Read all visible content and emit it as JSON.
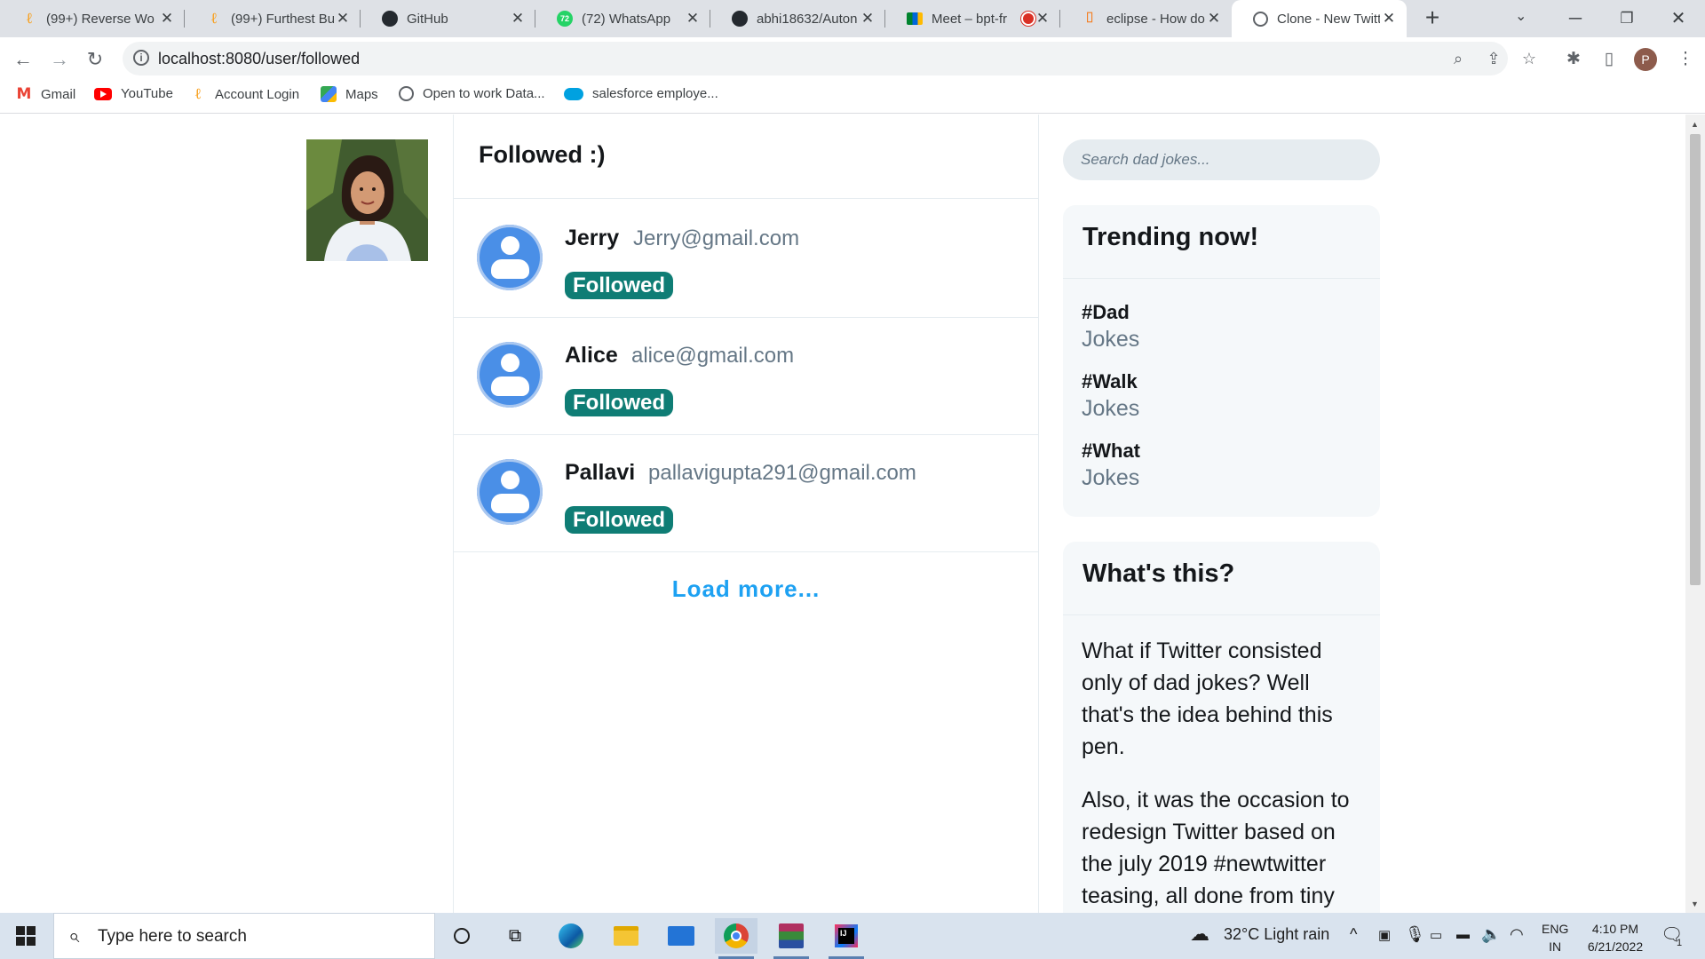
{
  "browser": {
    "tabs": [
      {
        "title": "(99+) Reverse Wo",
        "favicon": "leetcode-icon",
        "active": false
      },
      {
        "title": "(99+) Furthest Bu",
        "favicon": "leetcode-icon",
        "active": false
      },
      {
        "title": "GitHub",
        "favicon": "github-icon",
        "active": false
      },
      {
        "title": "(72) WhatsApp",
        "favicon": "whatsapp-icon",
        "badge": "72",
        "active": false
      },
      {
        "title": "abhi18632/Auton",
        "favicon": "github-icon",
        "active": false
      },
      {
        "title": "Meet – bpt-fr",
        "favicon": "meet-icon",
        "recording": true,
        "active": false
      },
      {
        "title": "eclipse - How do",
        "favicon": "stackoverflow-icon",
        "active": false
      },
      {
        "title": "Clone - New Twitt",
        "favicon": "globe-icon",
        "active": true
      }
    ],
    "url": "localhost:8080/user/followed",
    "profile_initial": "P",
    "bookmarks": [
      {
        "label": "Gmail",
        "icon": "gmail-icon"
      },
      {
        "label": "YouTube",
        "icon": "youtube-icon"
      },
      {
        "label": "Account Login",
        "icon": "leetcode-icon"
      },
      {
        "label": "Maps",
        "icon": "maps-icon"
      },
      {
        "label": "Open to work Data...",
        "icon": "globe-icon"
      },
      {
        "label": "salesforce employe...",
        "icon": "salesforce-icon"
      }
    ]
  },
  "feed": {
    "title": "Followed :)",
    "users": [
      {
        "name": "Jerry",
        "email": "Jerry@gmail.com",
        "status": "Followed"
      },
      {
        "name": "Alice",
        "email": "alice@gmail.com",
        "status": "Followed"
      },
      {
        "name": "Pallavi",
        "email": "pallavigupta291@gmail.com",
        "status": "Followed"
      }
    ],
    "load_more": "Load more..."
  },
  "sidebar": {
    "search_placeholder": "Search dad jokes...",
    "trending_title": "Trending now!",
    "trends": [
      {
        "tag": "#Dad",
        "sub": "Jokes"
      },
      {
        "tag": "#Walk",
        "sub": "Jokes"
      },
      {
        "tag": "#What",
        "sub": "Jokes"
      }
    ],
    "about_title": "What's this?",
    "about_paragraphs": [
      "What if Twitter consisted only of dad jokes? Well that's the idea behind this pen.",
      "Also, it was the occasion to redesign Twitter based on the july 2019 #newtwitter teasing, all done from tiny"
    ]
  },
  "taskbar": {
    "search_placeholder": "Type here to search",
    "weather": "32°C  Light rain",
    "language": "ENG",
    "region": "IN",
    "time": "4:10 PM",
    "date": "6/21/2022",
    "notifications": "1"
  },
  "colors": {
    "accent": "#1da1f2",
    "followed_badge": "#0f7d75",
    "avatar_blue": "#4a8fe7",
    "tabstrip": "#dee1e6",
    "taskbar": "#d9e3ee"
  }
}
